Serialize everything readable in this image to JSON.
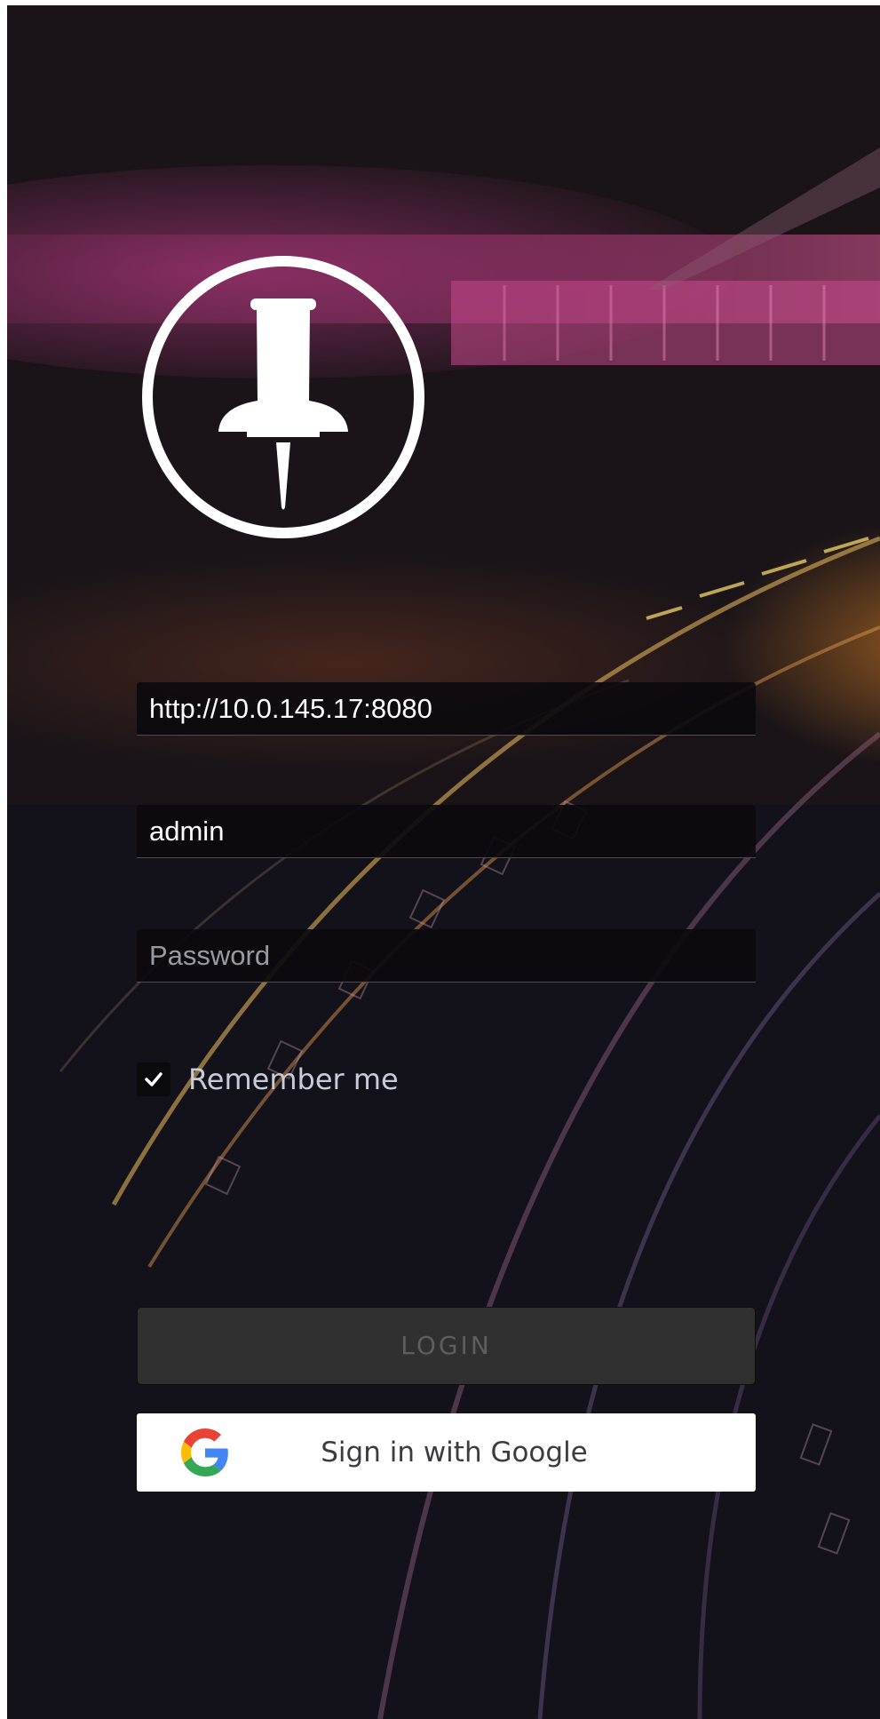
{
  "login": {
    "server_url": "http://10.0.145.17:8080",
    "username": "admin",
    "password_placeholder": "Password",
    "remember_label": "Remember me",
    "remember_checked": true,
    "login_label": "LOGIN",
    "google_label": "Sign in with Google"
  },
  "icons": {
    "logo": "pushpin-logo-icon",
    "check": "check-icon",
    "google": "google-logo-icon"
  },
  "colors": {
    "background": "#13111a",
    "login_button": "#303030",
    "login_text": "#5e5e5e",
    "google_button": "#ffffff"
  }
}
